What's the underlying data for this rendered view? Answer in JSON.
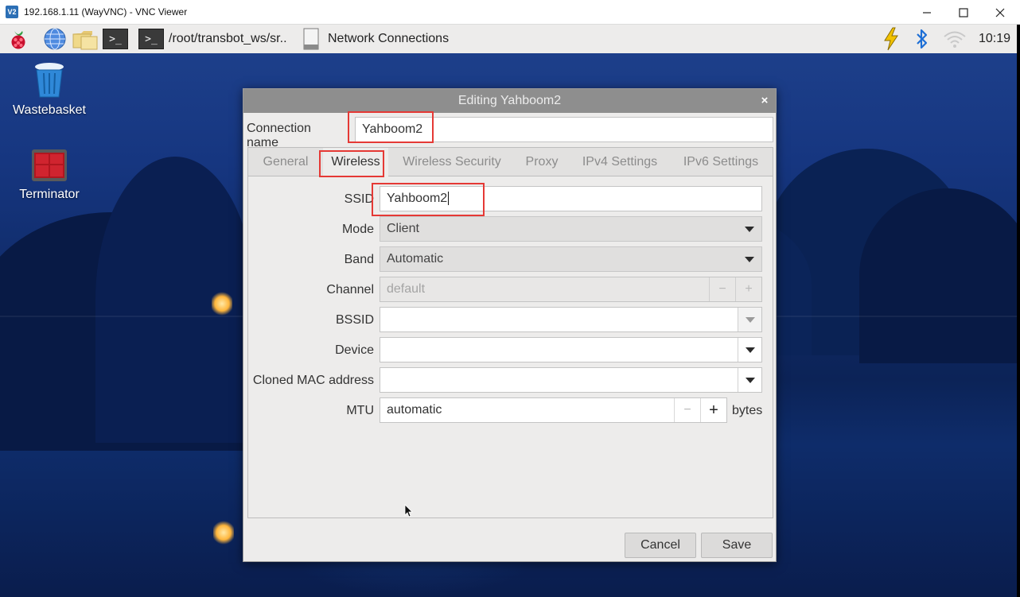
{
  "vnc": {
    "title": "192.168.1.11 (WayVNC) - VNC Viewer",
    "logo_text": "V2"
  },
  "panel": {
    "terminal_prompt": ">_",
    "task_terminal_title": "/root/transbot_ws/sr..",
    "task_network_title": "Network Connections",
    "time": "10:19"
  },
  "desktop": {
    "icons": [
      {
        "label": "Wastebasket",
        "icon": "trash-icon"
      },
      {
        "label": "Terminator",
        "icon": "terminator-icon"
      }
    ]
  },
  "dialog": {
    "title": "Editing Yahboom2",
    "close_glyph": "×",
    "connection_name_label": "Connection name",
    "connection_name_value": "Yahboom2",
    "tabs": [
      {
        "label": "General",
        "active": false
      },
      {
        "label": "Wireless",
        "active": true
      },
      {
        "label": "Wireless Security",
        "active": false
      },
      {
        "label": "Proxy",
        "active": false
      },
      {
        "label": "IPv4 Settings",
        "active": false
      },
      {
        "label": "IPv6 Settings",
        "active": false
      }
    ],
    "wireless": {
      "ssid_label": "SSID",
      "ssid_value": "Yahboom2",
      "mode_label": "Mode",
      "mode_value": "Client",
      "band_label": "Band",
      "band_value": "Automatic",
      "channel_label": "Channel",
      "channel_value": "default",
      "bssid_label": "BSSID",
      "bssid_value": "",
      "device_label": "Device",
      "device_value": "",
      "cloned_mac_label": "Cloned MAC address",
      "cloned_mac_value": "",
      "mtu_label": "MTU",
      "mtu_value": "automatic",
      "mtu_unit": "bytes",
      "minus": "−",
      "plus": "+"
    },
    "buttons": {
      "cancel": "Cancel",
      "save": "Save"
    }
  },
  "colors": {
    "highlight": "#e53935",
    "dialog_bg": "#edeceb",
    "titlebar": "#8e8e8e",
    "lightning": "#f2c200",
    "bluetooth": "#1e6fd6"
  }
}
